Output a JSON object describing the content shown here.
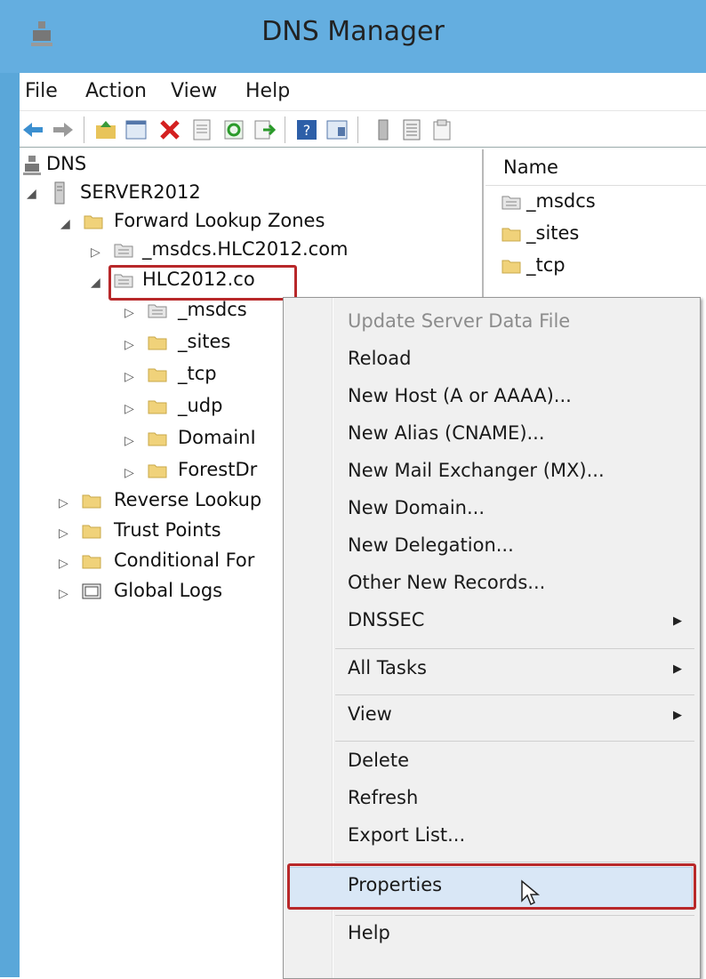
{
  "window": {
    "title": "DNS Manager"
  },
  "menubar": [
    "File",
    "Action",
    "View",
    "Help"
  ],
  "toolbar": [
    "back-icon",
    "forward-icon",
    "up-folder-icon",
    "show-tree-icon",
    "delete-icon",
    "properties-icon",
    "refresh-icon",
    "export-icon",
    "help-icon",
    "console-icon",
    "server-icon",
    "list-icon",
    "record-icon"
  ],
  "tree": {
    "root": "DNS",
    "server": "SERVER2012",
    "forward": "Forward Lookup Zones",
    "msdcs_zone": "_msdcs.HLC2012.com",
    "selected_zone": "HLC2012.co",
    "children": [
      "_msdcs",
      "_sites",
      "_tcp",
      "_udp",
      "DomainI",
      "ForestDr"
    ],
    "reverse": "Reverse Lookup",
    "trust": "Trust Points",
    "conditional": "Conditional For",
    "logs": "Global Logs"
  },
  "list": {
    "column_name": "Name",
    "items": [
      "_msdcs",
      "_sites",
      "_tcp"
    ]
  },
  "context_menu": {
    "update": "Update Server Data File",
    "reload": "Reload",
    "new_host": "New Host (A or AAAA)...",
    "new_alias": "New Alias (CNAME)...",
    "new_mx": "New Mail Exchanger (MX)...",
    "new_domain": "New Domain...",
    "new_delegation": "New Delegation...",
    "other_records": "Other New Records...",
    "dnssec": "DNSSEC",
    "all_tasks": "All Tasks",
    "view": "View",
    "delete": "Delete",
    "refresh": "Refresh",
    "export": "Export List...",
    "properties": "Properties",
    "help": "Help"
  },
  "colors": {
    "titlebar": "#64aee0",
    "highlight_border": "#b8282a",
    "hover": "#d9e7f6"
  }
}
